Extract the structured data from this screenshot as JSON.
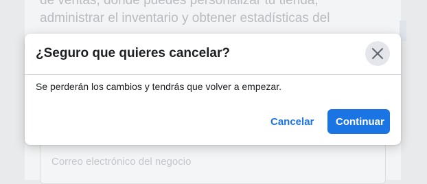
{
  "background": {
    "intro_text": "de ventas, donde puedes personalizar tu tienda, administrar el inventario y obtener estadísticas del",
    "email_placeholder": "Correo electrónico del negocio"
  },
  "dialog": {
    "title": "¿Seguro que quieres cancelar?",
    "message": "Se perderán los cambios y tendrás que volver a empezar.",
    "close_icon": "close-icon",
    "cancel_label": "Cancelar",
    "continue_label": "Continuar"
  },
  "colors": {
    "primary": "#1b74e4",
    "text": "#1c1e21",
    "close_bg": "#e4e6eb"
  }
}
